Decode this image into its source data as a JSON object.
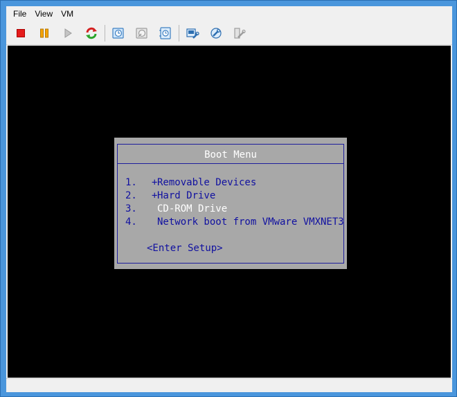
{
  "menubar": {
    "items": [
      {
        "label": "File"
      },
      {
        "label": "View"
      },
      {
        "label": "VM"
      }
    ]
  },
  "toolbar": {
    "buttons": [
      {
        "icon": "stop-icon"
      },
      {
        "icon": "pause-icon"
      },
      {
        "icon": "play-icon"
      },
      {
        "icon": "reset-icon"
      },
      {
        "icon": "snapshot-take-icon"
      },
      {
        "icon": "snapshot-revert-icon"
      },
      {
        "icon": "snapshot-manager-icon"
      },
      {
        "icon": "vm-settings-icon"
      },
      {
        "icon": "tools-install-icon"
      },
      {
        "icon": "vm-tools-icon"
      }
    ]
  },
  "boot_menu": {
    "title": "Boot Menu",
    "options": [
      {
        "number": "1.",
        "marker": "+",
        "label": "Removable Devices"
      },
      {
        "number": "2.",
        "marker": "+",
        "label": "Hard Drive"
      },
      {
        "number": "3.",
        "marker": "",
        "label": "CD-ROM Drive"
      },
      {
        "number": "4.",
        "marker": "",
        "label": "Network boot from VMware VMXNET3"
      }
    ],
    "setup_label": "<Enter Setup>"
  },
  "colors": {
    "window_frame": "#4a96dc",
    "vm_background": "#000000",
    "boot_panel": "#a8a8a8",
    "boot_border": "#1c1c9c",
    "boot_text": "#1010a0",
    "boot_title_text": "#ffffff"
  }
}
